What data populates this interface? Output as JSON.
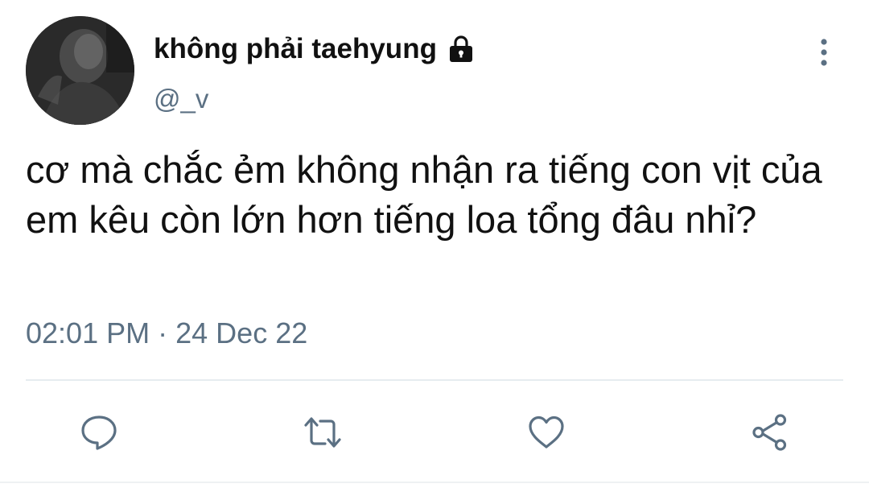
{
  "user": {
    "display_name": "không phải taehyung",
    "handle": "@_v",
    "protected": true
  },
  "tweet": {
    "text": "cơ mà chắc ẻm không nhận ra tiếng con vịt của em kêu còn lớn hơn tiếng loa tổng đâu nhỉ?",
    "time": "02:01 PM",
    "separator": "·",
    "date": "24 Dec 22"
  },
  "icons": {
    "lock": "lock-icon",
    "more": "more-vertical-icon",
    "reply": "reply-icon",
    "retweet": "retweet-icon",
    "like": "heart-icon",
    "share": "share-icon"
  },
  "colors": {
    "text": "#111111",
    "secondary": "#5b7083",
    "icon": "#5b7083",
    "divider": "#e6ecf0"
  }
}
